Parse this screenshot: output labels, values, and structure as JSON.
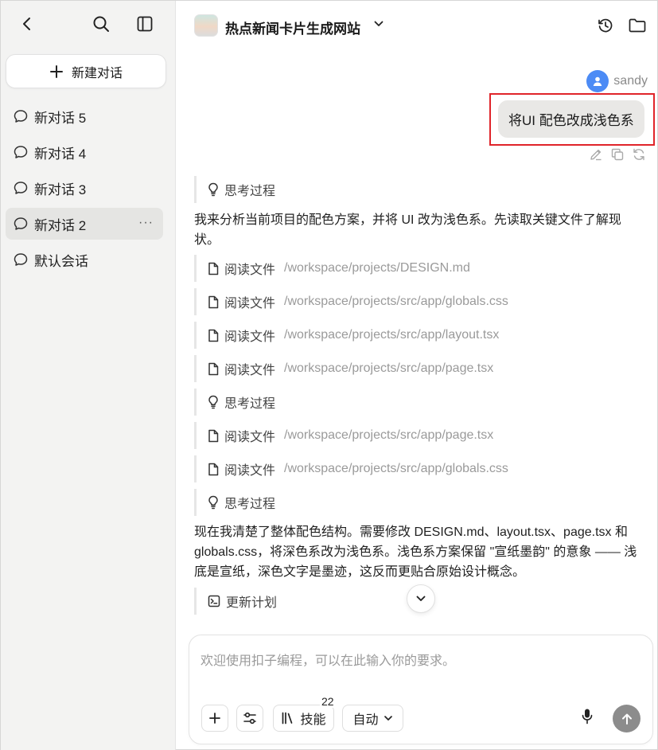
{
  "sidebar": {
    "new_chat_label": "新建对话",
    "conversations": [
      {
        "label": "新对话 5"
      },
      {
        "label": "新对话 4"
      },
      {
        "label": "新对话 3"
      },
      {
        "label": "新对话 2",
        "active": true,
        "more": "···"
      },
      {
        "label": "默认会话"
      }
    ]
  },
  "header": {
    "project_title": "热点新闻卡片生成网站"
  },
  "chat": {
    "user_name": "sandy",
    "user_message": "将UI 配色改成浅色系",
    "think_label": "思考过程",
    "read_label": "阅读文件",
    "plan_label": "更新计划",
    "paragraph1": "我来分析当前项目的配色方案，并将 UI 改为浅色系。先读取关键文件了解现状。",
    "paragraph2": "现在我清楚了整体配色结构。需要修改 DESIGN.md、layout.tsx、page.tsx 和 globals.css，将深色系改为浅色系。浅色系方案保留 \"宣纸墨韵\" 的意象 —— 浅底是宣纸，深色文字是墨迹，这反而更贴合原始设计概念。",
    "files": [
      "/workspace/projects/DESIGN.md",
      "/workspace/projects/src/app/globals.css",
      "/workspace/projects/src/app/layout.tsx",
      "/workspace/projects/src/app/page.tsx",
      "/workspace/projects/src/app/page.tsx",
      "/workspace/projects/src/app/globals.css"
    ]
  },
  "composer": {
    "placeholder": "欢迎使用扣子编程，可以在此输入你的要求。",
    "skills_label": "技能",
    "skills_count": "22",
    "mode_label": "自动"
  },
  "colors": {
    "accent_avatar": "#4c8bf5",
    "highlight_border": "#e0242a",
    "send_button": "#8c8c8c"
  }
}
